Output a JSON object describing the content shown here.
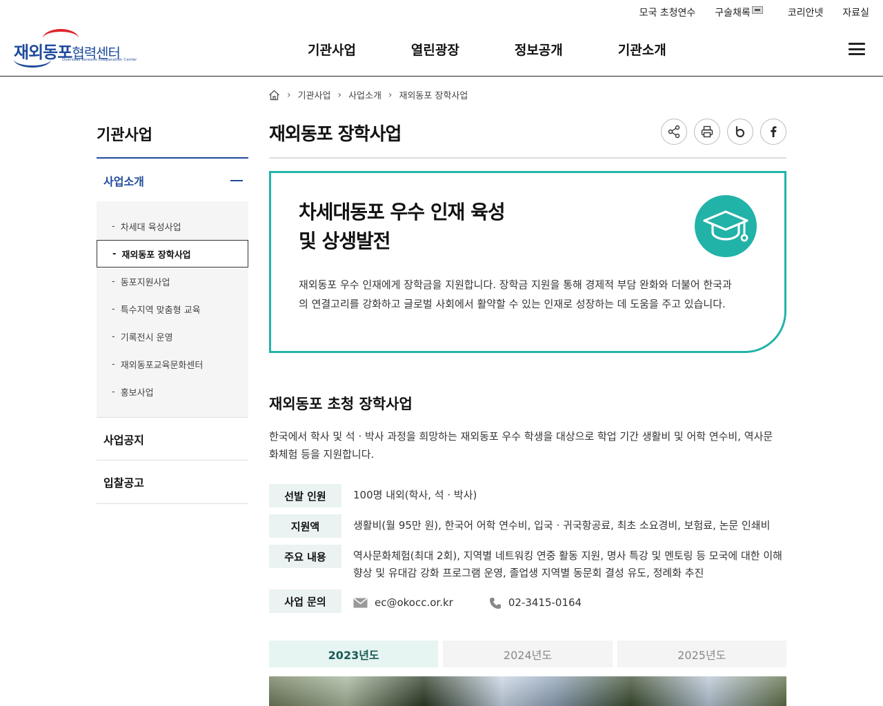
{
  "util_links": [
    "모국 초청연수",
    "구술채록",
    "코리안넷",
    "자료실"
  ],
  "logo": {
    "main": "재외동포",
    "sub": "협력센터",
    "english": "Overseas Koreans Cooperation Center"
  },
  "gnb": [
    "기관사업",
    "열린광장",
    "정보공개",
    "기관소개"
  ],
  "breadcrumb": [
    "기관사업",
    "사업소개",
    "재외동포 장학사업"
  ],
  "lnb": {
    "title": "기관사업",
    "category": "사업소개",
    "items": [
      "차세대 육성사업",
      "재외동포 장학사업",
      "동포지원사업",
      "특수지역 맞춤형 교육",
      "기록전시 운영",
      "재외동포교육문화센터",
      "홍보사업"
    ],
    "links": [
      "사업공지",
      "입찰공고"
    ]
  },
  "page_title": "재외동포 장학사업",
  "intro": {
    "heading_line1": "차세대동포 우수 인재 육성",
    "heading_line2": "및 상생발전",
    "text": "재외동포 우수 인재에게 장학금을 지원합니다. 장학금 지원을 통해 경제적 부담 완화와 더불어 한국과의 연결고리를 강화하고 글로벌 사회에서 활약할 수 있는 인재로 성장하는 데 도움을 주고 있습니다."
  },
  "section": {
    "title": "재외동포 초청 장학사업",
    "desc": "한국에서 학사 및 석 · 박사 과정을 희망하는 재외동포 우수 학생을 대상으로 학업 기간 생활비 및 어학 연수비, 역사문화체험 등을 지원합니다."
  },
  "info": {
    "row1": {
      "k": "선발 인원",
      "v": "100명 내외(학사, 석 · 박사)"
    },
    "row2": {
      "k": "지원액",
      "v": "생활비(월 95만 원), 한국어 어학 연수비, 입국 · 귀국항공료, 최초 소요경비, 보험료, 논문 인쇄비"
    },
    "row3": {
      "k": "주요 내용",
      "v": "역사문화체험(최대 2회), 지역별 네트워킹 연중 활동 지원, 명사 특강 및 멘토링 등 모국에 대한 이해 향상 및 유대감 강화 프로그램 운영, 졸업생 지역별 동문회 결성 유도, 정례화 추진"
    },
    "row4": {
      "k": "사업 문의",
      "email": "ec@okocc.or.kr",
      "phone": "02-3415-0164"
    }
  },
  "tabs": [
    "2023년도",
    "2024년도",
    "2025년도"
  ],
  "colors": {
    "teal": "#22b3a8",
    "navy": "#1e4a9a",
    "red": "#e0252f"
  }
}
